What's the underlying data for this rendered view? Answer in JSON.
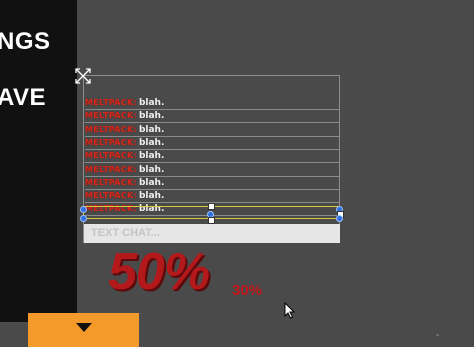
{
  "menu": {
    "settings_label": "NGS",
    "save_label": "AVE"
  },
  "chat": {
    "rows": [
      {
        "name": "MELTPACK:",
        "message": "blah."
      },
      {
        "name": "MELTPACK:",
        "message": "blah."
      },
      {
        "name": "MELTPACK:",
        "message": "blah."
      },
      {
        "name": "MELTPACK:",
        "message": "blah."
      },
      {
        "name": "MELTPACK:",
        "message": "blah."
      },
      {
        "name": "MELTPACK:",
        "message": "blah."
      },
      {
        "name": "MELTPACK:",
        "message": "blah."
      },
      {
        "name": "MELTPACK:",
        "message": "blah."
      },
      {
        "name": "MELTPACK:",
        "message": "blah."
      }
    ],
    "input_placeholder": "TEXT CHAT..."
  },
  "status": {
    "big_percent": "50%",
    "small_percent": "30%"
  },
  "colors": {
    "background": "#4a4a4a",
    "menu_panel": "#111111",
    "accent_orange": "#f39a2a",
    "player_name_red": "#d42a1e",
    "percent_red": "#b3181a",
    "selection_yellow": "#d6c93a",
    "handle_blue": "#2f6fe0"
  },
  "icons": {
    "move": "move-arrows-icon",
    "menu_arrow": "chevron-down-icon",
    "cursor": "mouse-pointer-icon"
  }
}
